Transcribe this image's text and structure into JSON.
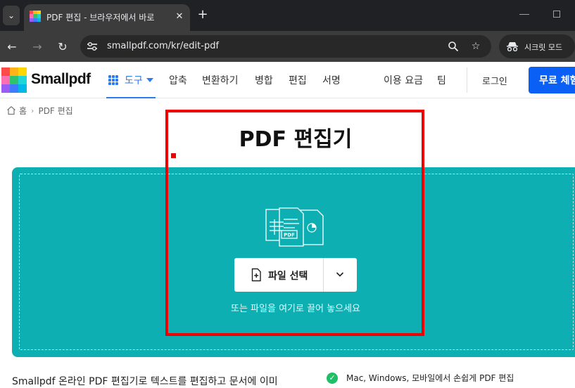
{
  "browser": {
    "tab_title": "PDF 편집 - 브라우저에서 바로",
    "url": "smallpdf.com/kr/edit-pdf",
    "incognito_label": "시크릿 모드"
  },
  "site": {
    "logo_text": "Smallpdf",
    "tools_label": "도구",
    "nav_items": [
      "압축",
      "변환하기",
      "병합",
      "편집",
      "서명"
    ],
    "pricing_label": "이용 요금",
    "team_label": "팀",
    "login_label": "로그인",
    "cta_label": "무료 체험"
  },
  "breadcrumb": {
    "home": "홈",
    "current": "PDF 편집"
  },
  "main": {
    "title": "PDF 편집기",
    "choose_file_label": "파일 선택",
    "drop_hint": "또는 파일을 여기로 끌어 놓으세요",
    "illustration_badge": "PDF"
  },
  "below": {
    "intro_text": "Smallpdf 온라인 PDF 편집기로 텍스트를 편집하고 문서에 이미",
    "feature_1": "Mac, Windows, 모바일에서 손쉽게 PDF 편집"
  },
  "colors": {
    "brand_teal": "#0dafb2",
    "primary_blue": "#0a5ff5",
    "highlight_red": "#ee0000",
    "success_green": "#1fbf67"
  }
}
